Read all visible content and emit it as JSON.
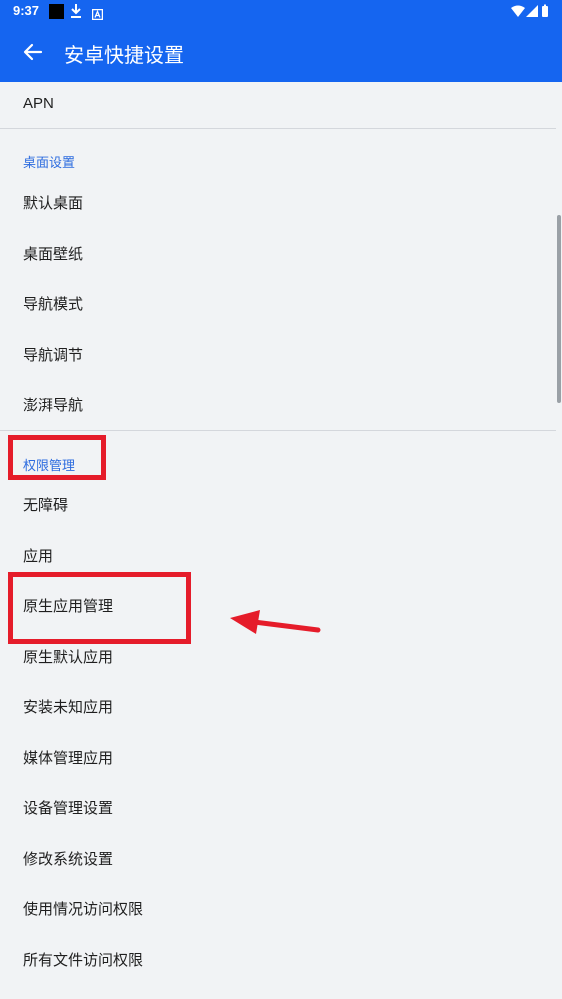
{
  "status_bar": {
    "time": "9:37",
    "icons": [
      "notification-square-icon",
      "download-icon",
      "app-icon",
      "wifi-icon",
      "signal-icon",
      "battery-icon"
    ]
  },
  "app_bar": {
    "title": "安卓快捷设置",
    "back_icon": "arrow-left-icon"
  },
  "items": {
    "apn": "APN"
  },
  "sections": {
    "desktop": {
      "header": "桌面设置",
      "items": [
        "默认桌面",
        "桌面壁纸",
        "导航模式",
        "导航调节",
        "澎湃导航"
      ]
    },
    "permissions": {
      "header": "权限管理",
      "items": [
        "无障碍",
        "应用",
        "原生应用管理",
        "原生默认应用",
        "安装未知应用",
        "媒体管理应用",
        "设备管理设置",
        "修改系统设置",
        "使用情况访问权限",
        "所有文件访问权限"
      ]
    }
  },
  "colors": {
    "primary": "#1565f0",
    "section_header": "#2d6cdf",
    "background": "#f1f3f5",
    "annotation": "#e51c2a"
  }
}
